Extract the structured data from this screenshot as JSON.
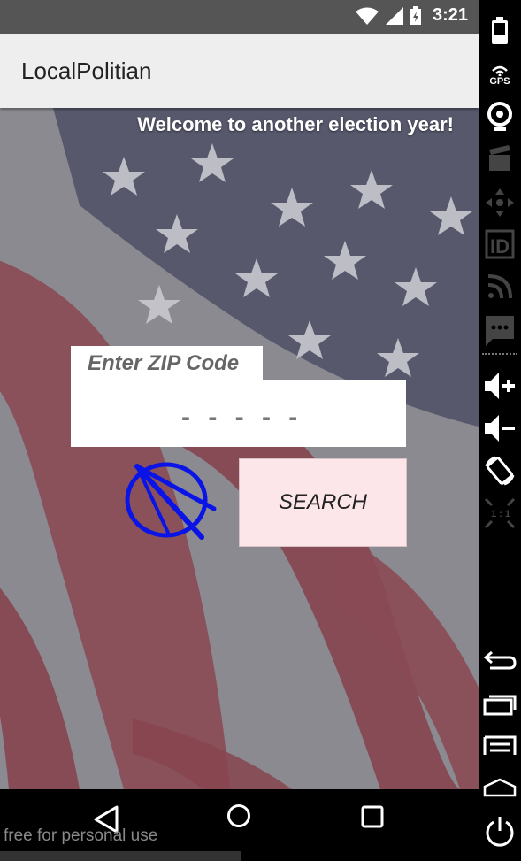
{
  "status_bar": {
    "time": "3:21"
  },
  "app": {
    "title": "LocalPolitian"
  },
  "main": {
    "welcome_text": "Welcome to another election year!",
    "zip_label": "Enter ZIP Code",
    "zip_placeholder": "- - - - -",
    "zip_value": "",
    "search_label": "SEARCH"
  },
  "nav": {
    "watermark": "free for personal use"
  },
  "sidebar": {
    "gps_label": "GPS",
    "id_label": "ID",
    "ratio_label": "1 : 1",
    "icons": [
      "battery-icon",
      "gps-icon",
      "camera-icon",
      "clapperboard-icon",
      "dpad-icon",
      "id-icon",
      "rss-icon",
      "sms-icon",
      "volume-up-icon",
      "volume-down-icon",
      "rotate-icon",
      "scale-icon",
      "back-arrow-icon",
      "recents-icon",
      "menu-icon",
      "home-icon",
      "power-icon"
    ]
  },
  "colors": {
    "appbar": "#eeeeee",
    "search_button": "#fde6ea",
    "compass": "#0a14e6"
  }
}
